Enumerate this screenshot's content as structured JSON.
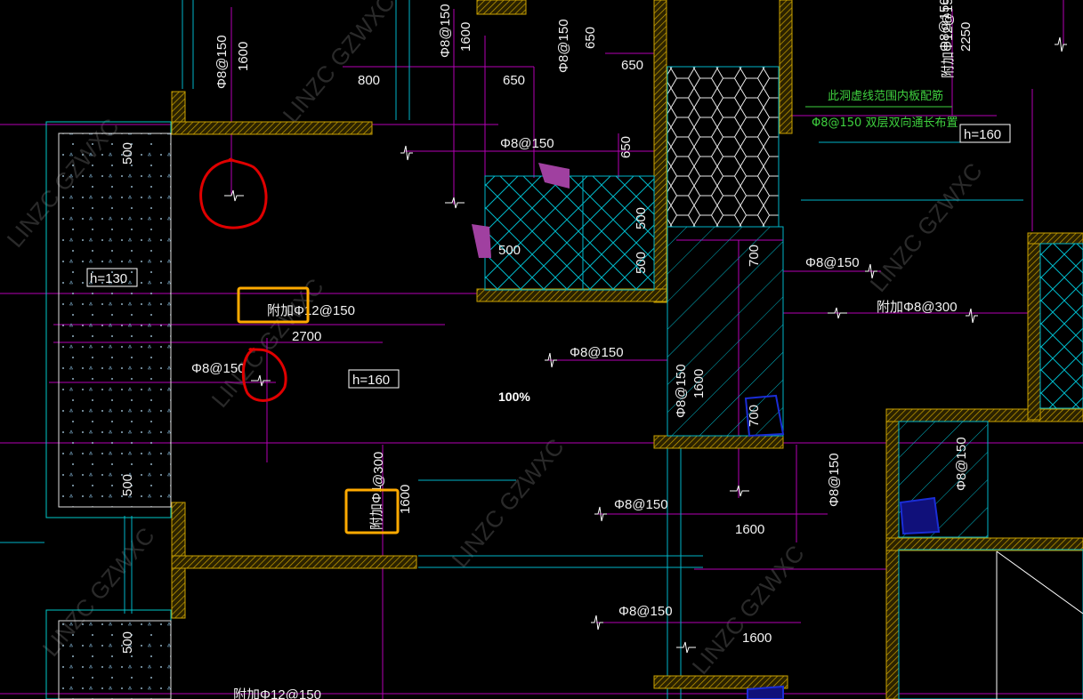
{
  "drawing": {
    "zoom": "100%",
    "watermark": "LINZC GZWXC",
    "note_green_1": "此洞虚线范围内板配筋",
    "note_green_2": "Φ8@150 双层双向通长布置",
    "rebar_labels": [
      {
        "id": "r1",
        "text": "Φ8@150",
        "vertical": true
      },
      {
        "id": "r2",
        "text": "1600",
        "vertical": true
      },
      {
        "id": "r3",
        "text": "Φ8@150",
        "vertical": true
      },
      {
        "id": "r4",
        "text": "1600",
        "vertical": true
      },
      {
        "id": "r5",
        "text": "Φ8@150",
        "vertical": true
      },
      {
        "id": "r6",
        "text": "650",
        "vertical": true
      },
      {
        "id": "r7",
        "text": "800",
        "vertical": false
      },
      {
        "id": "r8",
        "text": "650",
        "vertical": false
      },
      {
        "id": "r9",
        "text": "650",
        "vertical": false
      },
      {
        "id": "r10",
        "text": "Φ8@150",
        "vertical": false
      },
      {
        "id": "r11",
        "text": "650",
        "vertical": true
      },
      {
        "id": "r12",
        "text": "500",
        "vertical": true
      },
      {
        "id": "r13",
        "text": "500",
        "vertical": false
      },
      {
        "id": "r14",
        "text": "500",
        "vertical": true
      },
      {
        "id": "r15",
        "text": "500",
        "vertical": true
      },
      {
        "id": "r16",
        "text": "h=130",
        "vertical": false
      },
      {
        "id": "r17",
        "text": "附加Φ12@150",
        "vertical": false
      },
      {
        "id": "r18",
        "text": "2700",
        "vertical": false
      },
      {
        "id": "r19",
        "text": "Φ8@150",
        "vertical": false
      },
      {
        "id": "r20",
        "text": "h=160",
        "vertical": false
      },
      {
        "id": "r21",
        "text": "Φ8@150",
        "vertical": false
      },
      {
        "id": "r22",
        "text": "700",
        "vertical": true
      },
      {
        "id": "r23",
        "text": "Φ8@150",
        "vertical": false
      },
      {
        "id": "r24",
        "text": "附加Φ8@300",
        "vertical": false
      },
      {
        "id": "r25",
        "text": "Φ8@150",
        "vertical": true
      },
      {
        "id": "r26",
        "text": "1600",
        "vertical": true
      },
      {
        "id": "r27",
        "text": "700",
        "vertical": true
      },
      {
        "id": "r28",
        "text": "@300",
        "vertical": true
      },
      {
        "id": "r29",
        "text": "附加Φ1",
        "vertical": true
      },
      {
        "id": "r30",
        "text": "1600",
        "vertical": true
      },
      {
        "id": "r31",
        "text": "500",
        "vertical": true
      },
      {
        "id": "r32",
        "text": "Φ8@150",
        "vertical": false
      },
      {
        "id": "r33",
        "text": "1600",
        "vertical": false
      },
      {
        "id": "r34",
        "text": "Φ8@150",
        "vertical": true
      },
      {
        "id": "r35",
        "text": "Φ8@150",
        "vertical": true
      },
      {
        "id": "r36",
        "text": "Φ8@150",
        "vertical": false
      },
      {
        "id": "r37",
        "text": "1600",
        "vertical": false
      },
      {
        "id": "r38",
        "text": "500",
        "vertical": true
      },
      {
        "id": "r39",
        "text": "附加Φ12@150",
        "vertical": false
      },
      {
        "id": "r40",
        "text": "Φ8@150",
        "vertical": true
      },
      {
        "id": "r41",
        "text": "2250",
        "vertical": true
      },
      {
        "id": "r42",
        "text": "附加Φ12@150",
        "vertical": true
      },
      {
        "id": "r43",
        "text": "h=160",
        "vertical": false
      }
    ],
    "colors": {
      "magenta": "#d400d4",
      "cyan": "#00c8c8",
      "green_note": "#3ecf3e",
      "wall_hatch": "#c8a000",
      "red_annotation": "#e00000",
      "orange_box": "#ffaa00",
      "blue": "#1a2dd6"
    }
  }
}
